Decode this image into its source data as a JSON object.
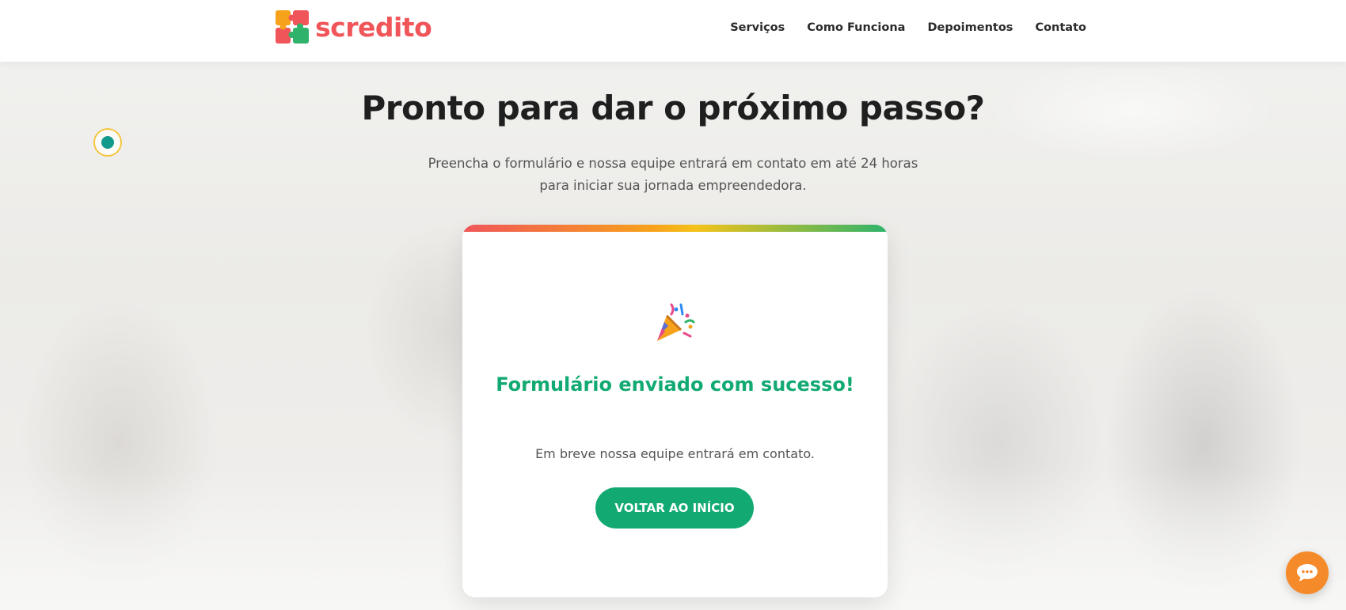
{
  "brand": {
    "name": "scredito"
  },
  "nav": {
    "items": [
      {
        "label": "Serviços"
      },
      {
        "label": "Como Funciona"
      },
      {
        "label": "Depoimentos"
      },
      {
        "label": "Contato"
      }
    ]
  },
  "hero": {
    "title": "Pronto para dar o próximo passo?",
    "subtitle": "Preencha o formulário e nossa equipe entrará em contato em até 24 horas para iniciar sua jornada empreendedora."
  },
  "card": {
    "icon": "party-popper-icon",
    "success_title": "Formulário enviado com sucesso!",
    "success_message": "Em breve nossa equipe entrará em contato.",
    "button_label": "VOLTAR AO INÍCIO"
  },
  "chat": {
    "icon": "chat-bubble-icon"
  },
  "colors": {
    "brand_red": "#f0555a",
    "success_green": "#12aa72",
    "chat_orange": "#f58a2b",
    "teal_dot": "#119a8c"
  }
}
